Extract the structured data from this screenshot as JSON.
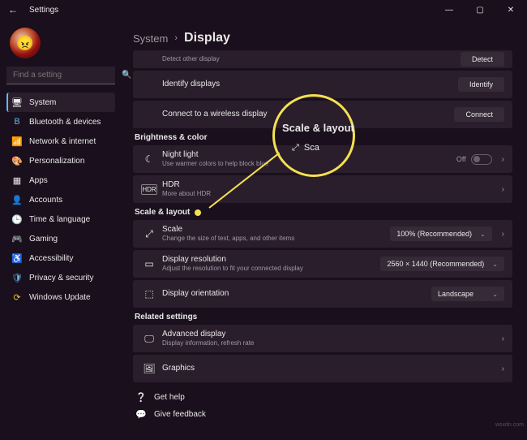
{
  "window": {
    "title": "Settings"
  },
  "search": {
    "placeholder": "Find a setting"
  },
  "sidebar": {
    "items": [
      {
        "icon": "🖥",
        "label": "System"
      },
      {
        "icon": "B",
        "label": "Bluetooth & devices"
      },
      {
        "icon": "📶",
        "label": "Network & internet"
      },
      {
        "icon": "🎨",
        "label": "Personalization"
      },
      {
        "icon": "▦",
        "label": "Apps"
      },
      {
        "icon": "👤",
        "label": "Accounts"
      },
      {
        "icon": "🕒",
        "label": "Time & language"
      },
      {
        "icon": "🎮",
        "label": "Gaming"
      },
      {
        "icon": "♿",
        "label": "Accessibility"
      },
      {
        "icon": "🛡",
        "label": "Privacy & security"
      },
      {
        "icon": "⟳",
        "label": "Windows Update"
      }
    ]
  },
  "breadcrumb": {
    "system": "System",
    "sep": "›",
    "display": "Display"
  },
  "sections": {
    "detect_row": {
      "title": "Detect other display",
      "button": "Detect"
    },
    "identify_row": {
      "title": "Identify displays",
      "button": "Identify"
    },
    "connect_row": {
      "title": "Connect to a wireless display",
      "button": "Connect"
    },
    "brightness_header": "Brightness & color",
    "nightlight": {
      "title": "Night light",
      "sub": "Use warmer colors to help block blue",
      "state": "Off"
    },
    "hdr": {
      "title": "HDR",
      "sub": "More about HDR"
    },
    "scale_header": "Scale & layout",
    "scale": {
      "title": "Scale",
      "sub": "Change the size of text, apps, and other items",
      "value": "100% (Recommended)"
    },
    "resolution": {
      "title": "Display resolution",
      "sub": "Adjust the resolution to fit your connected display",
      "value": "2560 × 1440 (Recommended)"
    },
    "orientation": {
      "title": "Display orientation",
      "value": "Landscape"
    },
    "related_header": "Related settings",
    "advanced": {
      "title": "Advanced display",
      "sub": "Display information, refresh rate"
    },
    "graphics": {
      "title": "Graphics"
    }
  },
  "links": {
    "help": "Get help",
    "feedback": "Give feedback"
  },
  "callout": {
    "label": "Scale & layout",
    "sub": "Sca"
  },
  "watermark": "wsxdn.com"
}
